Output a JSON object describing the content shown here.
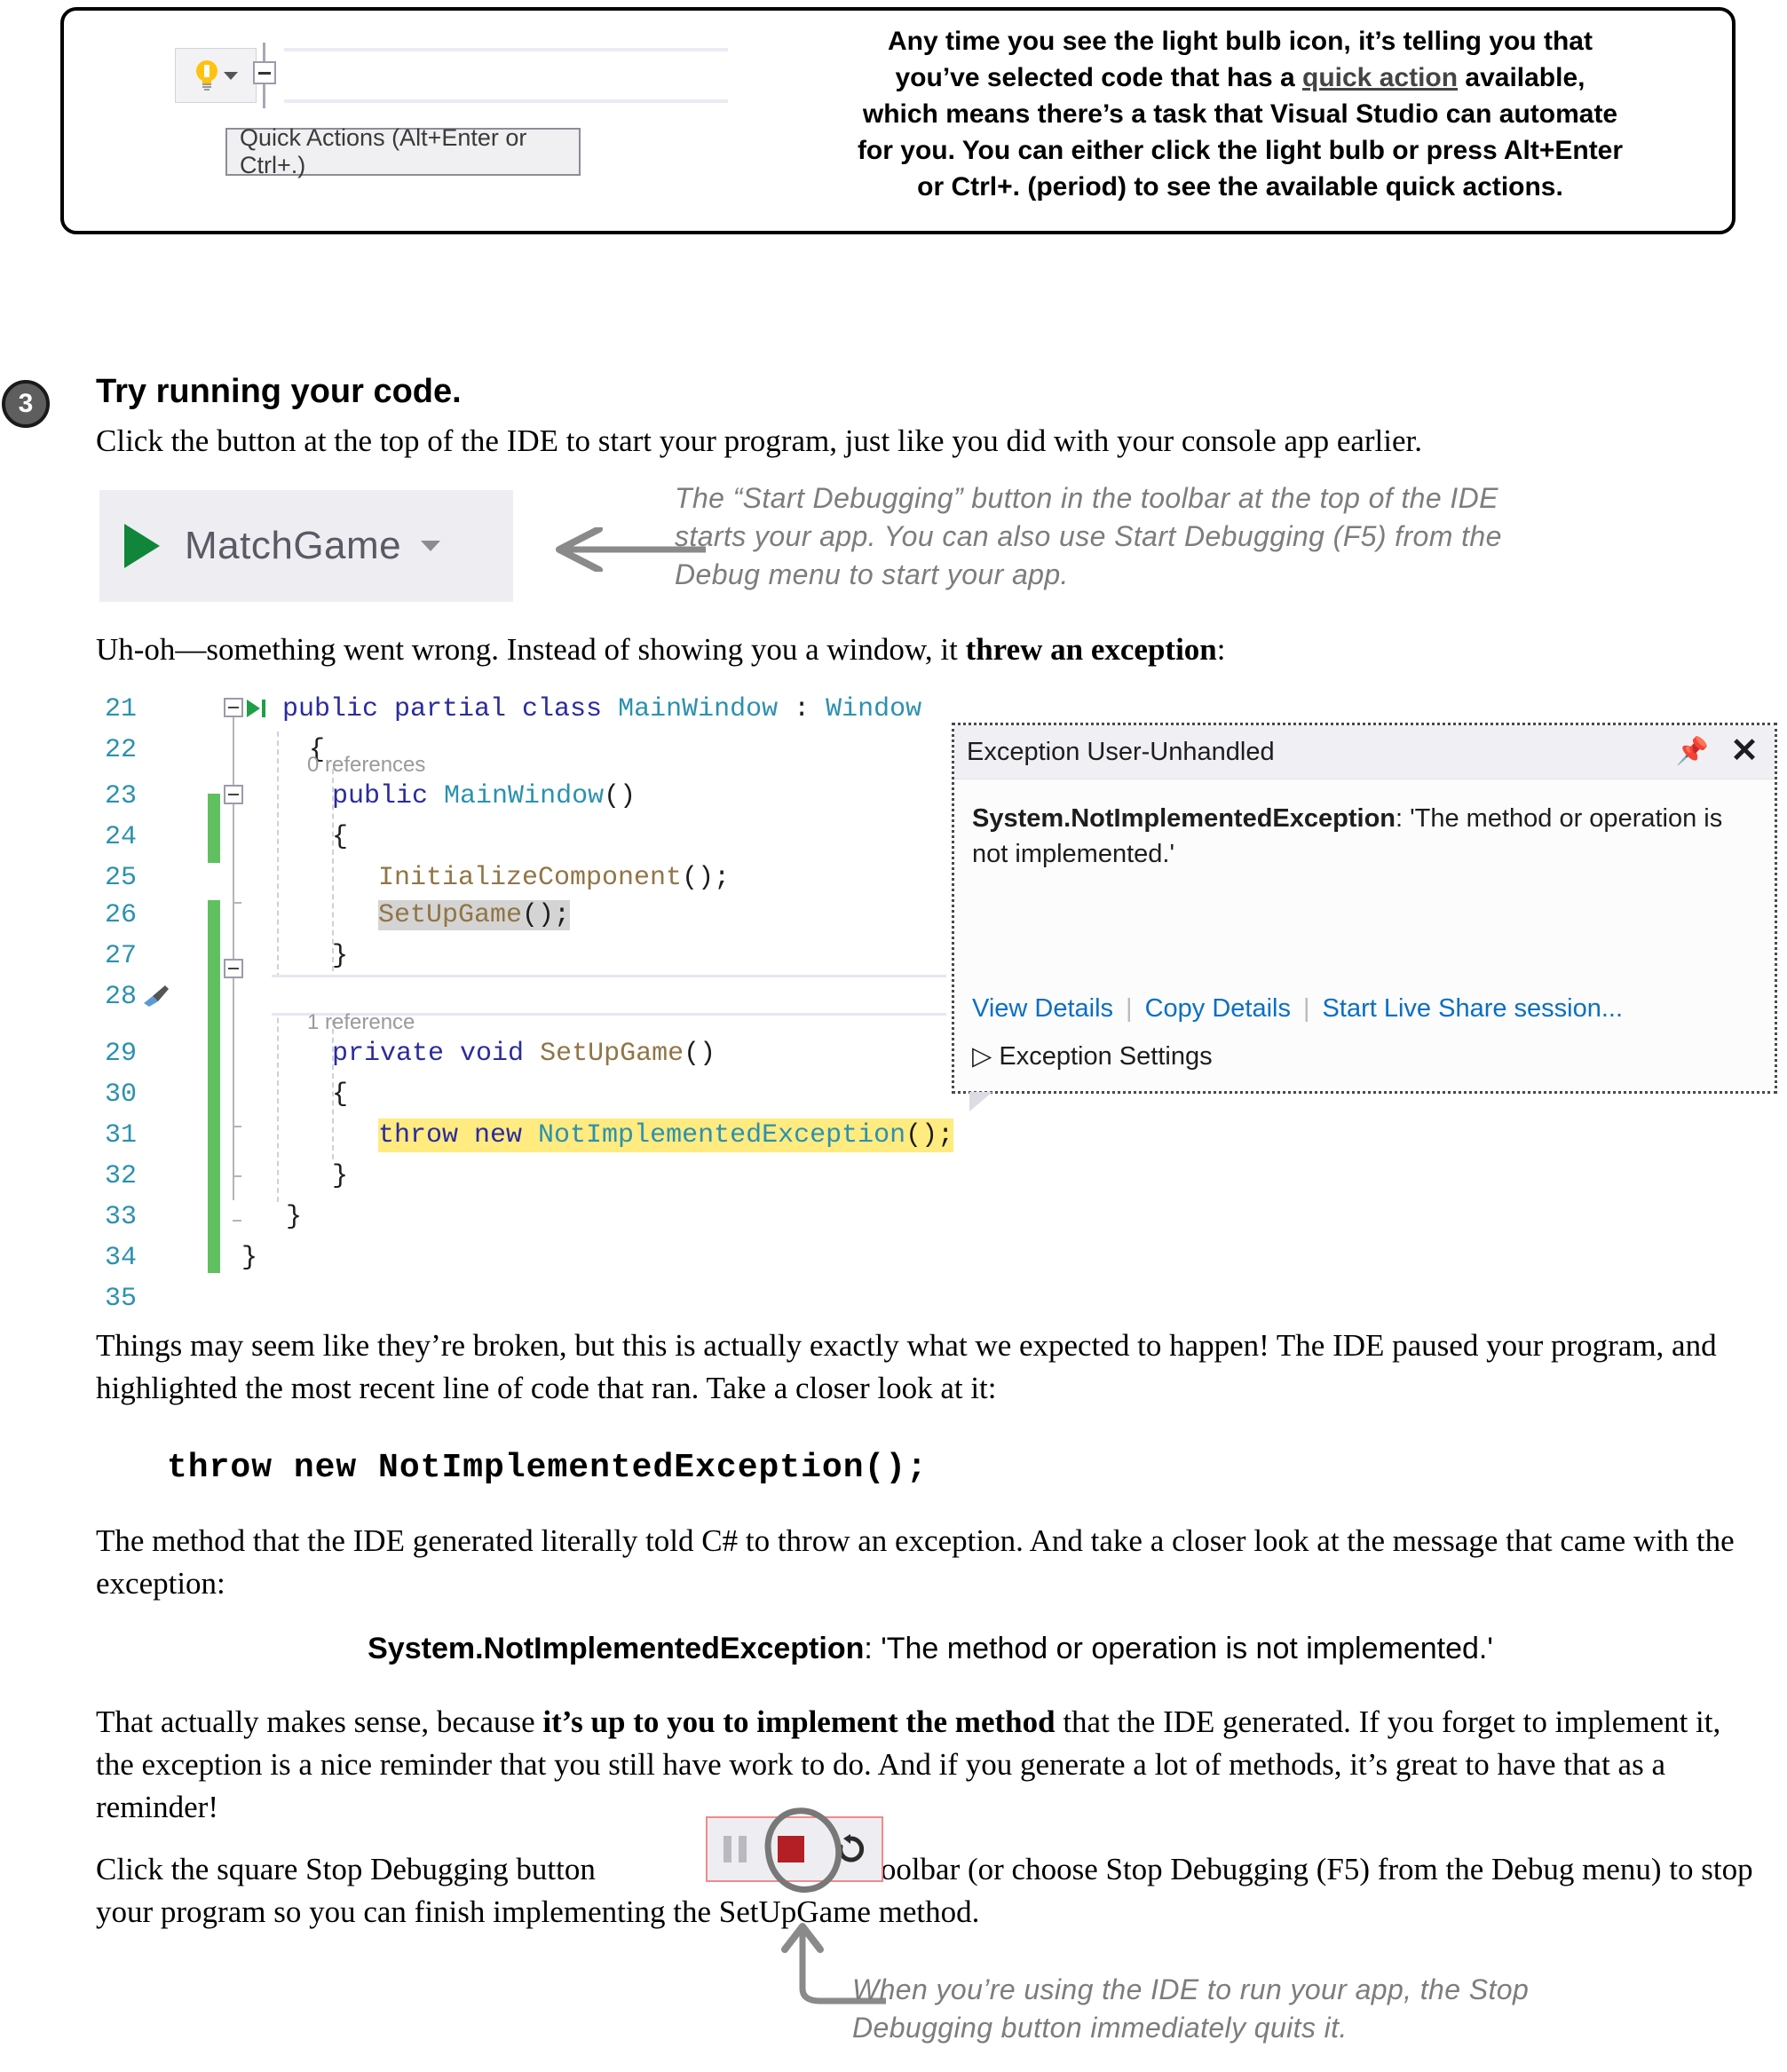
{
  "callout": {
    "text_lines": [
      "Any time you see the light bulb icon, it’s telling you that",
      "you’ve selected code that has a ",
      "quick action",
      " available,",
      "which means there’s a task that Visual Studio can automate",
      "for you. You can either click the light bulb or press Alt+Enter",
      "or Ctrl+. (period) to see the available quick actions."
    ],
    "tooltip_label": "Quick Actions (Alt+Enter or Ctrl+.)",
    "bulb_icon": "light-bulb-icon",
    "dropdown_icon": "chevron-down-icon"
  },
  "step": {
    "number": "3",
    "title": "Try running your code.",
    "description": "Click the button at the top of the IDE to start your program, just like you did with your console app earlier."
  },
  "run_button": {
    "label": "MatchGame",
    "play_icon": "play-triangle-icon",
    "dropdown_icon": "chevron-down-icon"
  },
  "annotations": {
    "start_debugging_note": "The “Start Debugging” button in the toolbar at the top of the IDE starts your app. You can also use Start Debugging (F5) from the Debug menu to start your app.",
    "stop_debugging_note": "When you’re using the IDE to run your app, the Stop Debugging button immediately quits it."
  },
  "uhoh_line": {
    "before": "Uh-oh—something went wrong. Instead of showing you a window, it ",
    "bold": "threw an exception",
    "after": ":"
  },
  "editor": {
    "lines": [
      {
        "no": "21",
        "text": "public partial class MainWindow : Window"
      },
      {
        "no": "22",
        "text": "{"
      },
      {
        "no": "23",
        "text": "public MainWindow()",
        "ref": "0 references"
      },
      {
        "no": "24",
        "text": "{"
      },
      {
        "no": "25",
        "text": "InitializeComponent();"
      },
      {
        "no": "26",
        "text": "SetUpGame();"
      },
      {
        "no": "27",
        "text": "}"
      },
      {
        "no": "28",
        "text": ""
      },
      {
        "no": "29",
        "text": "private void SetUpGame()",
        "ref": "1 reference"
      },
      {
        "no": "30",
        "text": "{"
      },
      {
        "no": "31",
        "text": "throw new NotImplementedException();"
      },
      {
        "no": "32",
        "text": "}"
      },
      {
        "no": "33",
        "text": "}"
      },
      {
        "no": "34",
        "text": "}"
      },
      {
        "no": "35",
        "text": ""
      }
    ],
    "error_marker": "error-icon",
    "brush_marker": "brush-icon"
  },
  "exception_panel": {
    "title": "Exception User-Unhandled",
    "pin_icon": "pin-icon",
    "close_icon": "close-icon",
    "exception_type": "System.NotImplementedException",
    "exception_message": ": 'The method or operation is not implemented.'",
    "links": [
      "View Details",
      "Copy Details",
      "Start Live Share session..."
    ],
    "settings_label": "Exception Settings",
    "settings_chevron": "chevron-right-icon"
  },
  "body": {
    "para1": "Things may seem like they’re broken, but this is actually exactly what we expected to happen! The IDE paused your program, and highlighted the most recent line of code that ran. Take a closer look at it:",
    "code_line": "throw new NotImplementedException();",
    "para2": "The method that the IDE generated literally told C# to throw an exception. And take a closer look at the message that came with the exception:",
    "exception_type": "System.NotImplementedException",
    "exception_message": ": 'The method or operation is not implemented.'",
    "para3_before": "That actually makes sense, because ",
    "para3_bold": "it’s up to you to implement the method",
    "para3_after": " that the IDE generated. If you forget to implement it, the exception is a nice reminder that you still have work to do. And if you generate a lot of methods, it’s great to have that as a reminder!",
    "para4_before": "Click the square Stop Debugging button",
    "para4_after": "in the toolbar (or choose Stop Debugging (F5) from the Debug menu) to stop your program so you can finish implementing the SetUpGame method."
  },
  "stop_toolbar": {
    "pause_icon": "pause-icon",
    "stop_icon": "stop-square-icon",
    "restart_icon": "restart-icon"
  },
  "colors": {
    "accent_yellow": "#ffc20e",
    "highlight_yellow": "#ffeb7f",
    "change_green": "#60c060",
    "error_red": "#d81625",
    "stop_red": "#b41f25",
    "link_blue": "#0a6fc2",
    "keyword_blue": "#2b2b9e",
    "type_teal": "#2b91af",
    "method_brown": "#917545",
    "annot_gray": "#7d7d7d"
  }
}
